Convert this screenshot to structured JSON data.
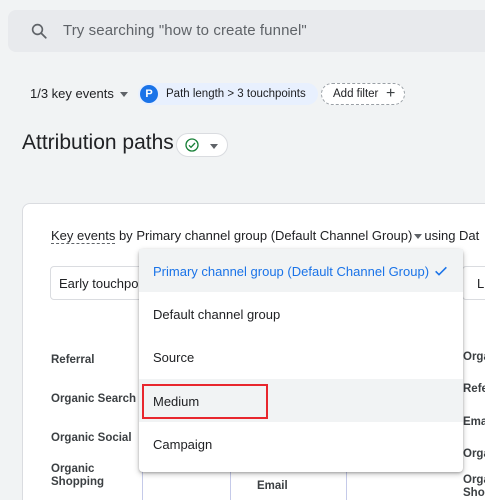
{
  "search": {
    "placeholder": "Try searching \"how to create funnel\""
  },
  "filters": {
    "key_events": "1/3 key events",
    "chip_badge": "P",
    "chip_label": "Path length > 3 touchpoints",
    "add_filter": "Add filter"
  },
  "page": {
    "title": "Attribution paths"
  },
  "card": {
    "metric": "Key events",
    "by": "by",
    "dimension": "Primary channel group (Default Channel Group)",
    "using": "using Dat",
    "early_touchpoints": "Early touchpo",
    "late_touchpoints": "L"
  },
  "left_labels": [
    "Referral",
    "Organic Search",
    "Organic Social",
    "Organic Shopping"
  ],
  "right_labels": [
    "Orga",
    "Refe",
    "Ema",
    "Orga",
    "Orga Shop"
  ],
  "bottom_label": "Email",
  "menu": {
    "items": [
      "Primary channel group (Default Channel Group)",
      "Default channel group",
      "Source",
      "Medium",
      "Campaign"
    ],
    "selected_index": 0,
    "hover_index": 3
  },
  "colors": {
    "accent": "#1a73e8",
    "highlight": "#e8262d",
    "chip_bg": "#e8f0fe"
  }
}
